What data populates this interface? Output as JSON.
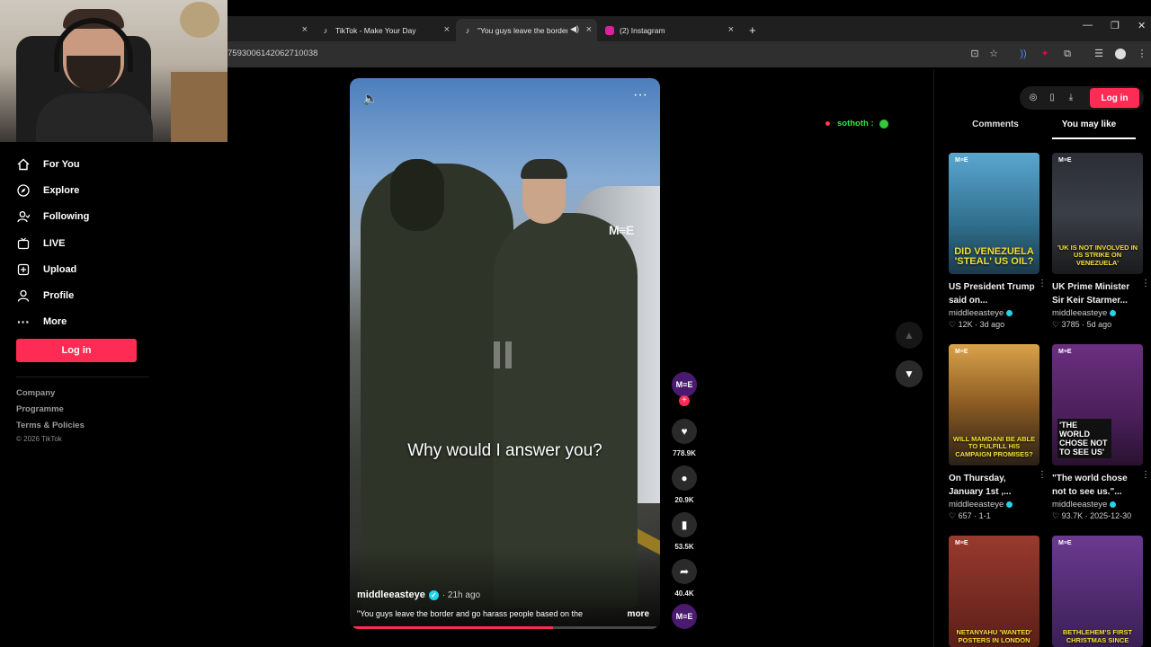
{
  "browser": {
    "tabs": [
      {
        "title": "",
        "icon": "blank-icon"
      },
      {
        "title": "TikTok - Make Your Day",
        "icon": "tiktok-icon"
      },
      {
        "title": "\"You guys leave the border",
        "icon": "tiktok-icon"
      },
      {
        "title": "(2) Instagram",
        "icon": "instagram-icon"
      }
    ],
    "url": "7593006142062710038"
  },
  "chat": {
    "user": "sothoth :"
  },
  "sidebar": {
    "items": [
      {
        "label": "For You",
        "icon": "home-icon"
      },
      {
        "label": "Explore",
        "icon": "compass-icon"
      },
      {
        "label": "Following",
        "icon": "user-follow-icon"
      },
      {
        "label": "LIVE",
        "icon": "live-icon"
      },
      {
        "label": "Upload",
        "icon": "upload-icon"
      },
      {
        "label": "Profile",
        "icon": "profile-icon"
      },
      {
        "label": "More",
        "icon": "more-icon"
      }
    ],
    "login": "Log in",
    "footer": [
      "Company",
      "Programme",
      "Terms & Policies"
    ],
    "copyright": "© 2026 TikTok"
  },
  "video": {
    "watermark": "M≡E",
    "caption": "Why would I answer you?",
    "author": "middleeasteye",
    "ago": "· 21h ago",
    "description": "\"You guys leave the border and go harass people based on the",
    "more": "more",
    "progress": 0.66
  },
  "actions": {
    "avatar": "M≡E",
    "likes": "778.9K",
    "comments": "20.9K",
    "saves": "53.5K",
    "shares": "40.4K"
  },
  "rightpanel": {
    "login": "Log in",
    "tabs": [
      "Comments",
      "You may like"
    ],
    "active_tab": "You may like",
    "cards": [
      {
        "thumb_text": "DID VENEZUELA 'STEAL' US OIL?",
        "title": "US President Trump said on...",
        "author": "middleeasteye",
        "likes": "♡ 12K · 3d ago",
        "bg": "#2f6e8c"
      },
      {
        "thumb_text": "'UK IS NOT INVOLVED IN US STRIKE ON VENEZUELA'",
        "title": "UK Prime Minister Sir Keir Starmer...",
        "author": "middleeasteye",
        "likes": "♡ 3785 · 5d ago",
        "bg": "#3b3f47"
      },
      {
        "thumb_text": "WILL MAMDANI BE ABLE TO FULFILL HIS CAMPAIGN PROMISES?",
        "title": "On Thursday, January 1st ,...",
        "author": "middleeasteye",
        "likes": "♡ 657 · 1-1",
        "bg": "#c68a2d"
      },
      {
        "thumb_text": "'THE WORLD CHOSE NOT TO SEE US'",
        "title": "\"The world chose not to see us.\"...",
        "author": "middleeasteye",
        "likes": "♡ 93.7K · 2025-12-30",
        "bg": "#5a2a6e"
      },
      {
        "thumb_text": "NETANYAHU 'WANTED' POSTERS IN LONDON",
        "title": "",
        "author": "",
        "likes": "",
        "bg": "#7a2a24"
      },
      {
        "thumb_text": "BETHLEHEM'S FIRST CHRISTMAS SINCE",
        "title": "",
        "author": "",
        "likes": "",
        "bg": "#4a2a6e"
      }
    ]
  }
}
